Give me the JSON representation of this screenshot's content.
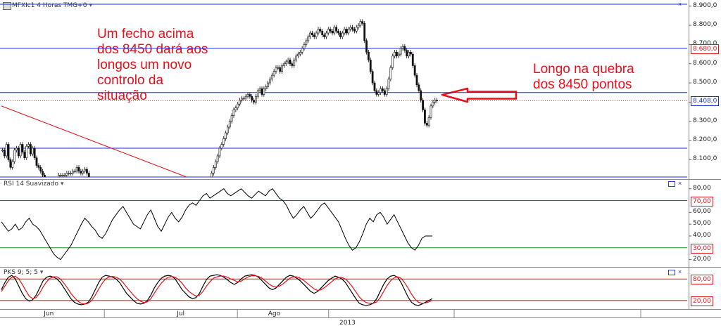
{
  "chart_data": [
    {
      "type": "candlestick",
      "title": "MFXIc1  4 Horas TMG+0",
      "y_ticks": [
        "8.900,0",
        "8.800,0",
        "8.700,0",
        "8.600,0",
        "8.500,0",
        "8.400,0",
        "8.300,0",
        "8.200,0",
        "8.100,0"
      ],
      "ylim": [
        8010,
        8910
      ],
      "price_labels": [
        {
          "text": "8.680,0",
          "value": 8680,
          "color": "#e8101a"
        },
        {
          "text": "8.408,0",
          "value": 8408,
          "color": "#1a2fd8"
        }
      ],
      "horizontal_lines": [
        {
          "value": 8910,
          "color": "#1a2fd8",
          "style": "solid"
        },
        {
          "value": 8680,
          "color": "#1a2fd8",
          "style": "solid"
        },
        {
          "value": 8450,
          "color": "#1a2fd8",
          "style": "solid"
        },
        {
          "value": 8408,
          "color": "#e8101a",
          "style": "dotted"
        },
        {
          "value": 8160,
          "color": "#1a2fd8",
          "style": "solid"
        },
        {
          "value": 8010,
          "color": "#1a2fd8",
          "style": "solid"
        }
      ],
      "trendline": {
        "from": [
          0,
          8380
        ],
        "to": [
          92,
          8010
        ],
        "color": "#e8101a"
      },
      "close": [
        8150,
        8120,
        8180,
        8100,
        8060,
        8090,
        8150,
        8160,
        8120,
        8180,
        8140,
        8110,
        8170,
        8180,
        8130,
        8160,
        8110,
        8070,
        8060,
        8040,
        8020,
        8010,
        8010,
        8010,
        8010,
        8010,
        8010,
        8010,
        8020,
        8020,
        8020,
        8020,
        8030,
        8030,
        8030,
        8040,
        8040,
        8060,
        8040,
        8030,
        8040,
        8050,
        8030,
        8010,
        8010,
        8010,
        8010,
        8010,
        8010,
        8010,
        8010,
        8010,
        8010,
        8010,
        8010,
        8010,
        8010,
        8010,
        8010,
        8010,
        8010,
        8010,
        8010,
        8010,
        8010,
        8010,
        8010,
        8010,
        8010,
        8010,
        8010,
        8010,
        8010,
        8010,
        8010,
        8010,
        8010,
        8010,
        8010,
        8010,
        8010,
        8010,
        8010,
        8010,
        8010,
        8010,
        8010,
        8010,
        8010,
        8010,
        8010,
        8010,
        8010,
        8010,
        8010,
        8010,
        8010,
        8010,
        8010,
        8010,
        8010,
        8010,
        8010,
        8010,
        8030,
        8060,
        8090,
        8120,
        8160,
        8180,
        8210,
        8240,
        8270,
        8300,
        8330,
        8360,
        8370,
        8390,
        8410,
        8420,
        8420,
        8430,
        8440,
        8430,
        8410,
        8400,
        8430,
        8460,
        8470,
        8440,
        8470,
        8480,
        8500,
        8520,
        8540,
        8560,
        8580,
        8580,
        8560,
        8590,
        8600,
        8610,
        8620,
        8600,
        8590,
        8620,
        8640,
        8650,
        8660,
        8680,
        8700,
        8720,
        8740,
        8760,
        8750,
        8740,
        8760,
        8780,
        8770,
        8750,
        8740,
        8760,
        8780,
        8770,
        8760,
        8790,
        8770,
        8760,
        8740,
        8760,
        8780,
        8760,
        8780,
        8790,
        8780,
        8770,
        8790,
        8800,
        8820,
        8810,
        8720,
        8660,
        8620,
        8560,
        8500,
        8460,
        8440,
        8450,
        8470,
        8460,
        8440,
        8470,
        8520,
        8580,
        8640,
        8660,
        8640,
        8650,
        8680,
        8690,
        8670,
        8640,
        8660,
        8650,
        8590,
        8540,
        8490,
        8460,
        8410,
        8360,
        8290,
        8280,
        8320,
        8380,
        8400,
        8410,
        8408
      ]
    },
    {
      "type": "line",
      "title": "RSI 14 Suavizado",
      "y_ticks": [
        "80,00",
        "60,00",
        "50,00",
        "40,00",
        "30,00",
        "20,00"
      ],
      "ylim": [
        15,
        84
      ],
      "level_labels": [
        {
          "text": "70,00",
          "value": 70,
          "color": "#e8101a"
        },
        {
          "text": "30,00",
          "value": 30,
          "color": "#e8101a"
        }
      ],
      "levels": [
        {
          "value": 70,
          "color": "#e8101a"
        },
        {
          "value": 30,
          "color": "#1b8a1b"
        }
      ],
      "values": [
        52,
        48,
        44,
        46,
        50,
        45,
        47,
        52,
        55,
        50,
        48,
        45,
        40,
        35,
        30,
        25,
        22,
        20,
        24,
        28,
        32,
        38,
        44,
        50,
        55,
        52,
        48,
        45,
        40,
        38,
        42,
        48,
        54,
        58,
        62,
        65,
        60,
        55,
        50,
        48,
        46,
        52,
        58,
        62,
        55,
        48,
        44,
        50,
        56,
        60,
        55,
        52,
        56,
        62,
        66,
        68,
        66,
        70,
        74,
        76,
        72,
        74,
        76,
        78,
        80,
        76,
        74,
        76,
        78,
        80,
        77,
        74,
        72,
        75,
        78,
        76,
        74,
        78,
        80,
        76,
        72,
        70,
        66,
        60,
        55,
        58,
        62,
        65,
        60,
        55,
        58,
        62,
        66,
        68,
        64,
        60,
        56,
        52,
        45,
        38,
        32,
        28,
        30,
        35,
        42,
        50,
        55,
        52,
        58,
        60,
        56,
        50,
        54,
        58,
        52,
        46,
        40,
        34,
        30,
        28,
        32,
        38,
        40,
        40,
        40
      ]
    },
    {
      "type": "line",
      "title": "PKS 9; 5; 5",
      "y_ticks": [
        "80,00",
        "20,00"
      ],
      "ylim": [
        0,
        100
      ],
      "level_labels": [
        {
          "text": "80,00",
          "value": 80,
          "color": "#e8101a"
        },
        {
          "text": "20,00",
          "value": 20,
          "color": "#e8101a"
        }
      ],
      "levels": [
        {
          "value": 80,
          "color": "#e8101a"
        },
        {
          "value": 20,
          "color": "#e8101a"
        }
      ],
      "series": [
        {
          "color": "#000000",
          "values": [
            50,
            70,
            85,
            90,
            80,
            60,
            40,
            25,
            18,
            22,
            35,
            55,
            75,
            85,
            88,
            85,
            80,
            70,
            55,
            40,
            25,
            15,
            10,
            8,
            10,
            15,
            30,
            50,
            70,
            85,
            90,
            88,
            85,
            80,
            70,
            55,
            40,
            30,
            20,
            12,
            10,
            12,
            20,
            35,
            55,
            70,
            82,
            88,
            90,
            88,
            80,
            65,
            50,
            40,
            30,
            25,
            28,
            40,
            60,
            78,
            88,
            90,
            92,
            90,
            85,
            78,
            70,
            65,
            70,
            80,
            88,
            90,
            92,
            90,
            85,
            75,
            65,
            55,
            50,
            55,
            65,
            75,
            85,
            90,
            88,
            82,
            75,
            65,
            55,
            45,
            40,
            45,
            55,
            65,
            75,
            82,
            88,
            85,
            80,
            70,
            55,
            40,
            25,
            12,
            8,
            6,
            8,
            12,
            25,
            45,
            65,
            80,
            88,
            90,
            85,
            70,
            50,
            30,
            15,
            8,
            6,
            10,
            15,
            20,
            25
          ]
        },
        {
          "color": "#e8101a",
          "values": [
            45,
            60,
            75,
            85,
            88,
            80,
            65,
            48,
            32,
            25,
            28,
            40,
            58,
            72,
            82,
            86,
            86,
            80,
            68,
            55,
            40,
            28,
            18,
            12,
            10,
            12,
            20,
            35,
            52,
            68,
            80,
            86,
            87,
            85,
            80,
            70,
            58,
            46,
            35,
            25,
            18,
            14,
            16,
            25,
            40,
            55,
            68,
            78,
            85,
            87,
            85,
            78,
            68,
            55,
            45,
            38,
            32,
            35,
            45,
            60,
            72,
            82,
            86,
            88,
            88,
            85,
            80,
            76,
            72,
            74,
            80,
            86,
            89,
            89,
            87,
            82,
            74,
            66,
            60,
            58,
            60,
            66,
            74,
            82,
            86,
            86,
            82,
            76,
            68,
            60,
            52,
            48,
            50,
            56,
            64,
            72,
            80,
            84,
            84,
            80,
            70,
            58,
            44,
            30,
            20,
            14,
            12,
            12,
            16,
            28,
            45,
            62,
            75,
            83,
            86,
            82,
            70,
            55,
            38,
            24,
            15,
            12,
            13,
            16,
            20
          ]
        }
      ]
    }
  ],
  "annotations": {
    "left": [
      "Um fecho acima",
      "dos 8450 dará aos",
      "longos um novo",
      "controlo da",
      "situação"
    ],
    "right": [
      "Longo na quebra",
      "dos 8450 pontos"
    ]
  },
  "x_axis": {
    "months": [
      {
        "label": "Jun",
        "position": 0.068
      },
      {
        "label": "Jul",
        "position": 0.262
      },
      {
        "label": "Ago",
        "position": 0.395
      }
    ],
    "year": "2013"
  }
}
